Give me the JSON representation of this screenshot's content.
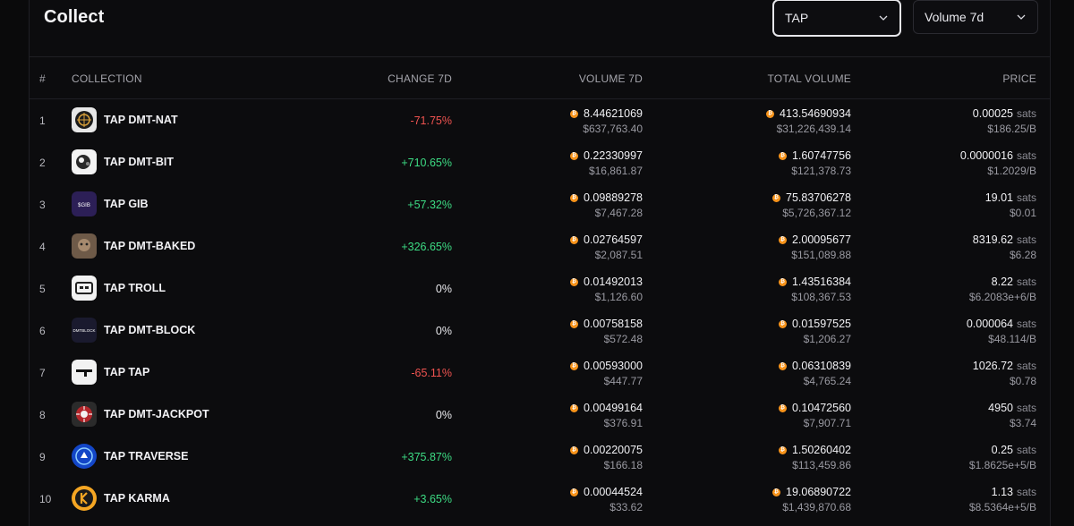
{
  "header": {
    "title": "Collect",
    "filter_select": {
      "value": "TAP"
    },
    "period_select": {
      "value": "Volume 7d"
    }
  },
  "table": {
    "columns": {
      "rank": "#",
      "collection": "COLLECTION",
      "change": "CHANGE 7D",
      "volume": "VOLUME 7D",
      "total": "TOTAL VOLUME",
      "price": "PRICE"
    },
    "price_unit": "sats",
    "rows": [
      {
        "rank": "1",
        "name": "TAP DMT-NAT",
        "change": "-71.75%",
        "trend": "neg",
        "vol_btc": "8.44621069",
        "vol_usd": "$637,763.40",
        "total_btc": "413.54690934",
        "total_usd": "$31,226,439.14",
        "price": "0.00025",
        "price_usd": "$186.25/B"
      },
      {
        "rank": "2",
        "name": "TAP DMT-BIT",
        "change": "+710.65%",
        "trend": "pos",
        "vol_btc": "0.22330997",
        "vol_usd": "$16,861.87",
        "total_btc": "1.60747756",
        "total_usd": "$121,378.73",
        "price": "0.0000016",
        "price_usd": "$1.2029/B"
      },
      {
        "rank": "3",
        "name": "TAP GIB",
        "change": "+57.32%",
        "trend": "pos",
        "vol_btc": "0.09889278",
        "vol_usd": "$7,467.28",
        "total_btc": "75.83706278",
        "total_usd": "$5,726,367.12",
        "price": "19.01",
        "price_usd": "$0.01"
      },
      {
        "rank": "4",
        "name": "TAP DMT-BAKED",
        "change": "+326.65%",
        "trend": "pos",
        "vol_btc": "0.02764597",
        "vol_usd": "$2,087.51",
        "total_btc": "2.00095677",
        "total_usd": "$151,089.88",
        "price": "8319.62",
        "price_usd": "$6.28"
      },
      {
        "rank": "5",
        "name": "TAP TROLL",
        "change": "0%",
        "trend": "zero",
        "vol_btc": "0.01492013",
        "vol_usd": "$1,126.60",
        "total_btc": "1.43516384",
        "total_usd": "$108,367.53",
        "price": "8.22",
        "price_usd": "$6.2083e+6/B"
      },
      {
        "rank": "6",
        "name": "TAP DMT-BLOCK",
        "change": "0%",
        "trend": "zero",
        "vol_btc": "0.00758158",
        "vol_usd": "$572.48",
        "total_btc": "0.01597525",
        "total_usd": "$1,206.27",
        "price": "0.000064",
        "price_usd": "$48.114/B"
      },
      {
        "rank": "7",
        "name": "TAP TAP",
        "change": "-65.11%",
        "trend": "neg",
        "vol_btc": "0.00593000",
        "vol_usd": "$447.77",
        "total_btc": "0.06310839",
        "total_usd": "$4,765.24",
        "price": "1026.72",
        "price_usd": "$0.78"
      },
      {
        "rank": "8",
        "name": "TAP DMT-JACKPOT",
        "change": "0%",
        "trend": "zero",
        "vol_btc": "0.00499164",
        "vol_usd": "$376.91",
        "total_btc": "0.10472560",
        "total_usd": "$7,907.71",
        "price": "4950",
        "price_usd": "$3.74"
      },
      {
        "rank": "9",
        "name": "TAP TRAVERSE",
        "change": "+375.87%",
        "trend": "pos",
        "vol_btc": "0.00220075",
        "vol_usd": "$166.18",
        "total_btc": "1.50260402",
        "total_usd": "$113,459.86",
        "price": "0.25",
        "price_usd": "$1.8625e+5/B"
      },
      {
        "rank": "10",
        "name": "TAP KARMA",
        "change": "+3.65%",
        "trend": "pos",
        "vol_btc": "0.00044524",
        "vol_usd": "$33.62",
        "total_btc": "19.06890722",
        "total_usd": "$1,439,870.68",
        "price": "1.13",
        "price_usd": "$8.5364e+5/B"
      }
    ]
  },
  "colors": {
    "negative": "#ef5350",
    "positive": "#3ddc84",
    "bitcoin": "#f7931a"
  }
}
